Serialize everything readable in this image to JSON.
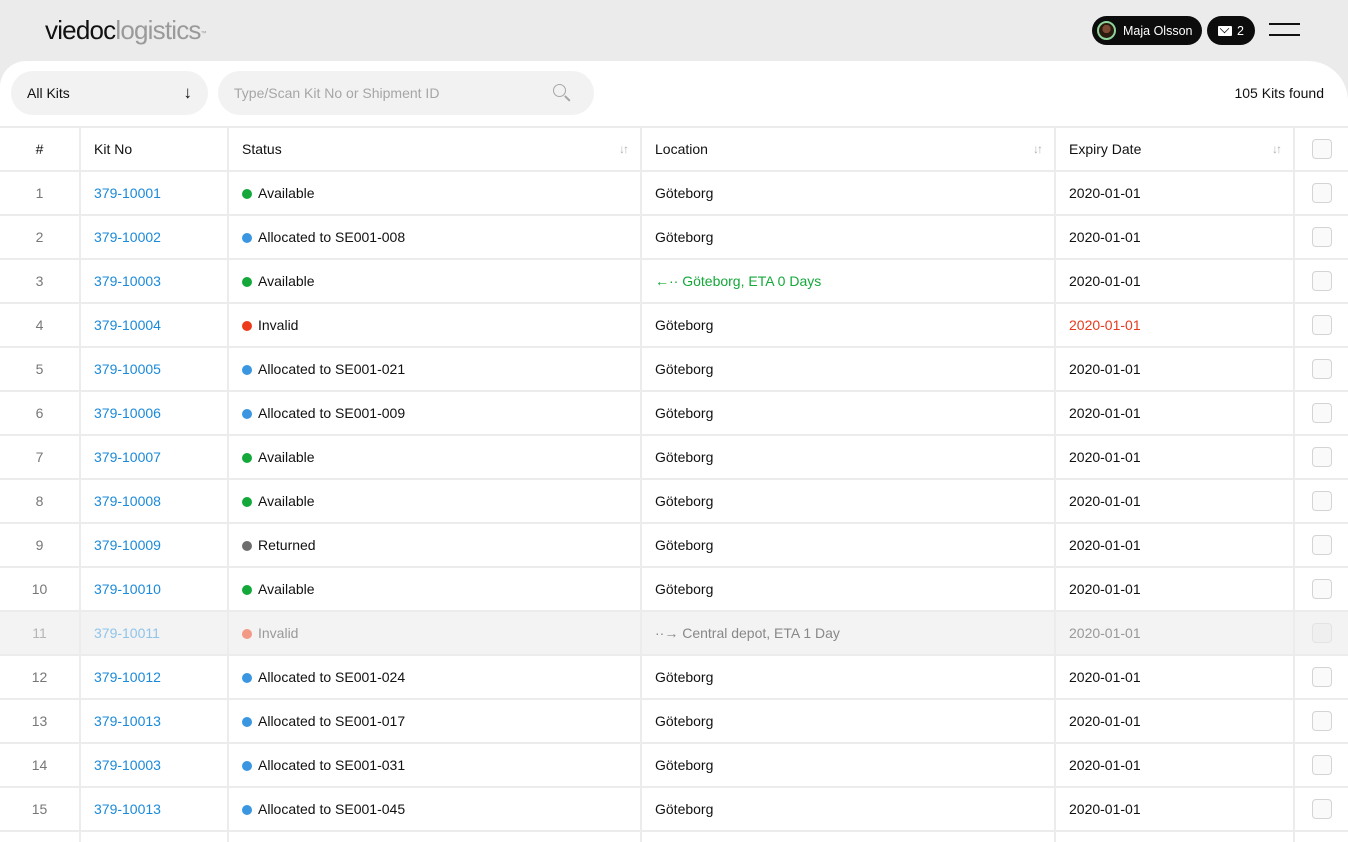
{
  "header": {
    "brand": "viedoc",
    "product": "logistics",
    "trademark": "™",
    "user_name": "Maja Olsson",
    "mail_count": "2",
    "icons": {
      "avatar": "user-avatar",
      "mail": "envelope-icon",
      "menu": "hamburger-menu-icon"
    }
  },
  "toolbar": {
    "filter_label": "All Kits",
    "filter_icon": "↓",
    "search_placeholder": "Type/Scan Kit No or Shipment ID",
    "search_value": "",
    "results_count": "105 Kits found"
  },
  "table": {
    "columns": {
      "num": "#",
      "kit": "Kit No",
      "status": "Status",
      "location": "Location",
      "expiry": "Expiry Date"
    },
    "sort_icon": "↓↑",
    "status_colors": {
      "Available": "#14a83a",
      "Allocated": "#3a96e0",
      "Invalid": "#ee3a1c",
      "Returned": "#6e6e6e",
      "InvalidDimmed": "#f29a86"
    },
    "rows": [
      {
        "num": "1",
        "kit": "379-10001",
        "status": "Available",
        "status_type": "Available",
        "location": "Göteborg",
        "location_type": "normal",
        "expiry": "2020-01-01",
        "expiry_type": "normal"
      },
      {
        "num": "2",
        "kit": "379-10002",
        "status": "Allocated to SE001-008",
        "status_type": "Allocated",
        "location": "Göteborg",
        "location_type": "normal",
        "expiry": "2020-01-01",
        "expiry_type": "normal"
      },
      {
        "num": "3",
        "kit": "379-10003",
        "status": "Available",
        "status_type": "Available",
        "location": "←·· Göteborg, ETA 0 Days",
        "location_type": "incoming",
        "expiry": "2020-01-01",
        "expiry_type": "normal"
      },
      {
        "num": "4",
        "kit": "379-10004",
        "status": "Invalid",
        "status_type": "Invalid",
        "location": "Göteborg",
        "location_type": "normal",
        "expiry": "2020-01-01",
        "expiry_type": "expired"
      },
      {
        "num": "5",
        "kit": "379-10005",
        "status": "Allocated to SE001-021",
        "status_type": "Allocated",
        "location": "Göteborg",
        "location_type": "normal",
        "expiry": "2020-01-01",
        "expiry_type": "normal"
      },
      {
        "num": "6",
        "kit": "379-10006",
        "status": "Allocated to SE001-009",
        "status_type": "Allocated",
        "location": "Göteborg",
        "location_type": "normal",
        "expiry": "2020-01-01",
        "expiry_type": "normal"
      },
      {
        "num": "7",
        "kit": "379-10007",
        "status": "Available",
        "status_type": "Available",
        "location": "Göteborg",
        "location_type": "normal",
        "expiry": "2020-01-01",
        "expiry_type": "normal"
      },
      {
        "num": "8",
        "kit": "379-10008",
        "status": "Available",
        "status_type": "Available",
        "location": "Göteborg",
        "location_type": "normal",
        "expiry": "2020-01-01",
        "expiry_type": "normal"
      },
      {
        "num": "9",
        "kit": "379-10009",
        "status": "Returned",
        "status_type": "Returned",
        "location": "Göteborg",
        "location_type": "normal",
        "expiry": "2020-01-01",
        "expiry_type": "normal"
      },
      {
        "num": "10",
        "kit": "379-10010",
        "status": "Available",
        "status_type": "Available",
        "location": "Göteborg",
        "location_type": "normal",
        "expiry": "2020-01-01",
        "expiry_type": "normal"
      },
      {
        "num": "11",
        "kit": "379-10011",
        "status": "Invalid",
        "status_type": "InvalidDimmed",
        "location": "··→ Central depot, ETA 1 Day",
        "location_type": "outgoing",
        "expiry": "2020-01-01",
        "expiry_type": "normal",
        "dimmed": true
      },
      {
        "num": "12",
        "kit": "379-10012",
        "status": "Allocated to SE001-024",
        "status_type": "Allocated",
        "location": "Göteborg",
        "location_type": "normal",
        "expiry": "2020-01-01",
        "expiry_type": "normal"
      },
      {
        "num": "13",
        "kit": "379-10013",
        "status": "Allocated to SE001-017",
        "status_type": "Allocated",
        "location": "Göteborg",
        "location_type": "normal",
        "expiry": "2020-01-01",
        "expiry_type": "normal"
      },
      {
        "num": "14",
        "kit": "379-10003",
        "status": "Allocated to SE001-031",
        "status_type": "Allocated",
        "location": "Göteborg",
        "location_type": "normal",
        "expiry": "2020-01-01",
        "expiry_type": "normal"
      },
      {
        "num": "15",
        "kit": "379-10013",
        "status": "Allocated to SE001-045",
        "status_type": "Allocated",
        "location": "Göteborg",
        "location_type": "normal",
        "expiry": "2020-01-01",
        "expiry_type": "normal"
      },
      {
        "num": "",
        "kit": "",
        "status": "",
        "status_type": "",
        "location": "",
        "location_type": "normal",
        "expiry": "",
        "expiry_type": "normal",
        "partial": true
      }
    ]
  }
}
